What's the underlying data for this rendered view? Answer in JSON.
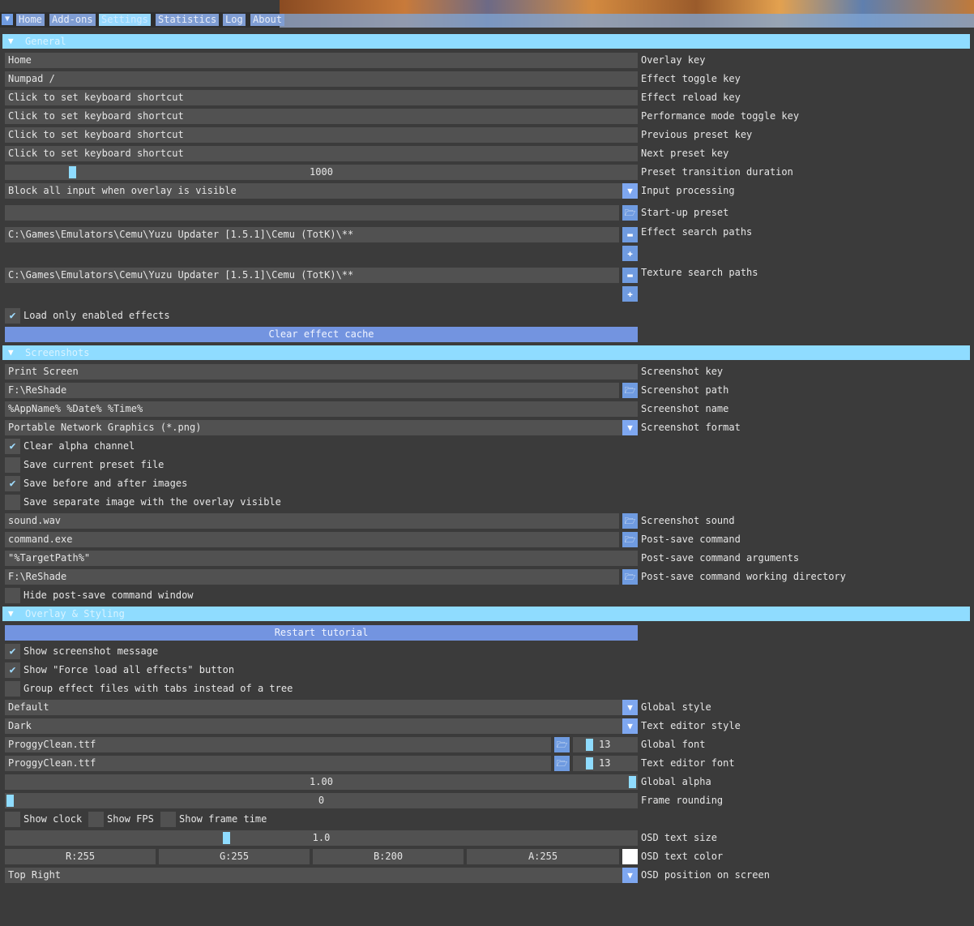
{
  "menu": {
    "tabs": [
      "Home",
      "Add-ons",
      "Settings",
      "Statistics",
      "Log",
      "About"
    ],
    "active_tab": "Settings"
  },
  "general": {
    "header": "General",
    "overlay_key": {
      "value": "Home",
      "label": "Overlay key"
    },
    "effect_toggle_key": {
      "value": "Numpad /",
      "label": "Effect toggle key"
    },
    "effect_reload_key": {
      "value": "Click to set keyboard shortcut",
      "label": "Effect reload key"
    },
    "performance_mode_key": {
      "value": "Click to set keyboard shortcut",
      "label": "Performance mode toggle key"
    },
    "previous_preset_key": {
      "value": "Click to set keyboard shortcut",
      "label": "Previous preset key"
    },
    "next_preset_key": {
      "value": "Click to set keyboard shortcut",
      "label": "Next preset key"
    },
    "preset_transition": {
      "value": "1000",
      "label": "Preset transition duration",
      "fraction": 0.1
    },
    "input_processing": {
      "value": "Block all input when overlay is visible",
      "label": "Input processing"
    },
    "startup_preset": {
      "value": "",
      "label": "Start-up preset"
    },
    "effect_search_paths": {
      "value": "C:\\Games\\Emulators\\Cemu\\Yuzu Updater [1.5.1]\\Cemu (TotK)\\**",
      "label": "Effect search paths"
    },
    "texture_search_paths": {
      "value": "C:\\Games\\Emulators\\Cemu\\Yuzu Updater [1.5.1]\\Cemu (TotK)\\**",
      "label": "Texture search paths"
    },
    "load_only_enabled": {
      "label": "Load only enabled effects",
      "checked": true
    },
    "clear_cache_button": "Clear effect cache"
  },
  "screenshots": {
    "header": "Screenshots",
    "key": {
      "value": "Print Screen",
      "label": "Screenshot key"
    },
    "path": {
      "value": "F:\\ReShade",
      "label": "Screenshot path"
    },
    "name": {
      "value": "%AppName% %Date% %Time%",
      "label": "Screenshot name"
    },
    "format": {
      "value": "Portable Network Graphics (*.png)",
      "label": "Screenshot format"
    },
    "clear_alpha": {
      "label": "Clear alpha channel",
      "checked": true
    },
    "save_preset": {
      "label": "Save current preset file",
      "checked": false
    },
    "save_before_after": {
      "label": "Save before and after images",
      "checked": true
    },
    "save_overlay": {
      "label": "Save separate image with the overlay visible",
      "checked": false
    },
    "sound": {
      "value": "sound.wav",
      "label": "Screenshot sound"
    },
    "post_cmd": {
      "value": "command.exe",
      "label": "Post-save command"
    },
    "post_args": {
      "value": "\"%TargetPath%\"",
      "label": "Post-save command arguments"
    },
    "post_dir": {
      "value": "F:\\ReShade",
      "label": "Post-save command working directory"
    },
    "hide_window": {
      "label": "Hide post-save command window",
      "checked": false
    }
  },
  "overlay": {
    "header": "Overlay & Styling",
    "restart_tutorial": "Restart tutorial",
    "show_screenshot_msg": {
      "label": "Show screenshot message",
      "checked": true
    },
    "show_force_load": {
      "label": "Show \"Force load all effects\" button",
      "checked": true
    },
    "group_tabs": {
      "label": "Group effect files with tabs instead of a tree",
      "checked": false
    },
    "global_style": {
      "value": "Default",
      "label": "Global style"
    },
    "text_editor_style": {
      "value": "Dark",
      "label": "Text editor style"
    },
    "global_font": {
      "value": "ProggyClean.ttf",
      "size": "13",
      "label": "Global font"
    },
    "text_editor_font": {
      "value": "ProggyClean.ttf",
      "size": "13",
      "label": "Text editor font"
    },
    "global_alpha": {
      "value": "1.00",
      "label": "Global alpha",
      "fraction": 1.0
    },
    "frame_rounding": {
      "value": "0",
      "label": "Frame rounding",
      "fraction": 0.0
    },
    "show_clock": {
      "label": "Show clock",
      "checked": false
    },
    "show_fps": {
      "label": "Show FPS",
      "checked": false
    },
    "show_frame_time": {
      "label": "Show frame time",
      "checked": false
    },
    "osd_text_size": {
      "value": "1.0",
      "label": "OSD text size",
      "fraction": 0.35
    },
    "osd_color": {
      "r": "R:255",
      "g": "G:255",
      "b": "B:200",
      "a": "A:255",
      "label": "OSD text color",
      "swatch": "#ffffff"
    },
    "osd_position": {
      "value": "Top Right",
      "label": "OSD position on screen"
    }
  },
  "colors": {
    "accent": "#8fdcff",
    "button": "#7394e0",
    "frame": "#515151",
    "background": "#3b3b3b"
  }
}
